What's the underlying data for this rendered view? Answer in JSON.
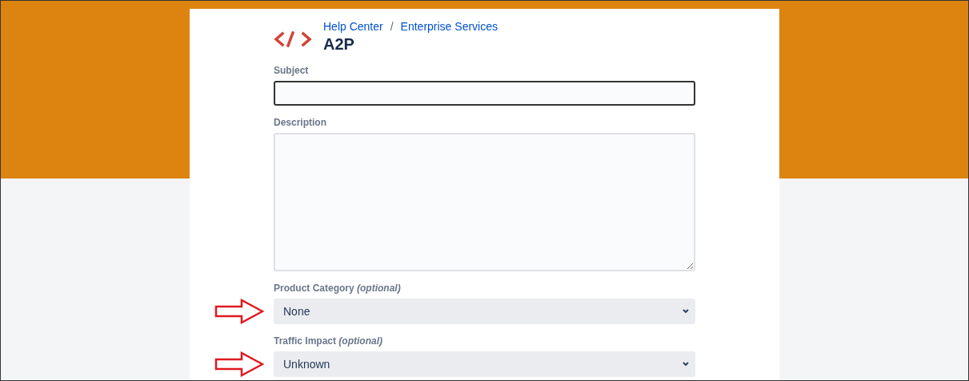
{
  "breadcrumb": [
    {
      "label": "Help Center"
    },
    {
      "label": "Enterprise Services"
    }
  ],
  "breadcrumb_separator": "/",
  "title": "A2P",
  "fields": [
    {
      "kind": "text",
      "label": "Subject",
      "focused": true,
      "arrow": false
    },
    {
      "kind": "textarea",
      "label": "Description",
      "focused": false,
      "arrow": false
    },
    {
      "kind": "select",
      "label": "Product Category *(optional)*",
      "value": "None",
      "focused": false,
      "arrow": true
    },
    {
      "kind": "select",
      "label": "Traffic Impact *(optional)*",
      "value": "Unknown",
      "focused": false,
      "arrow": true
    }
  ]
}
